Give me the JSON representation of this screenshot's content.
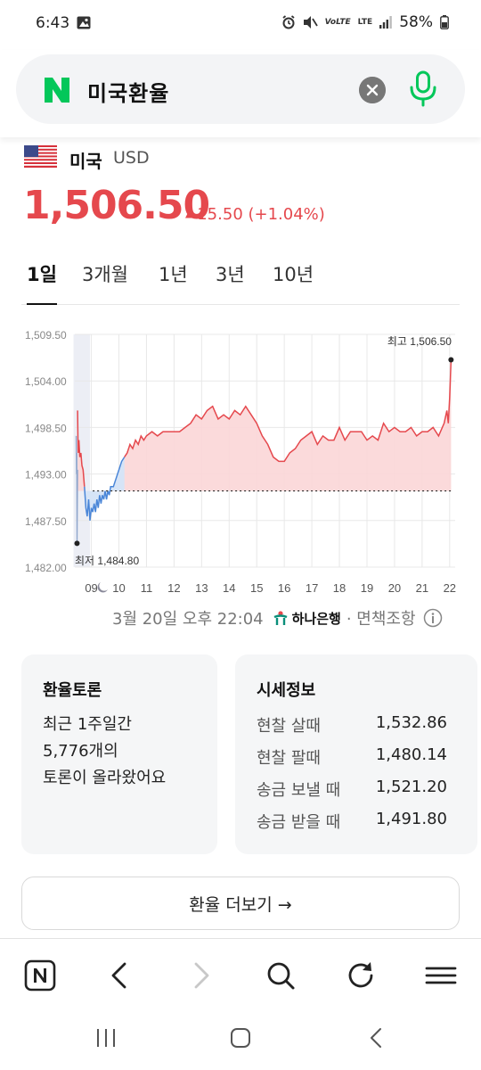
{
  "status_bar": {
    "time": "6:43",
    "network": "LTE",
    "volte": "VoLTE",
    "battery": "58%"
  },
  "search": {
    "query": "미국환율",
    "brand_color": "#03c75a"
  },
  "currency": {
    "country": "미국",
    "code": "USD",
    "rate": "1,506.50",
    "change": "15.50 (+1.04%)",
    "accent_color": "#e5484d"
  },
  "tabs": [
    {
      "label": "1일",
      "active": true
    },
    {
      "label": "3개월",
      "active": false
    },
    {
      "label": "1년",
      "active": false
    },
    {
      "label": "3년",
      "active": false
    },
    {
      "label": "10년",
      "active": false
    }
  ],
  "chart_data": {
    "type": "line",
    "y_ticks": [
      "1,509.50",
      "1,504.00",
      "1,498.50",
      "1,493.00",
      "1,487.50",
      "1,482.00"
    ],
    "ylim": [
      1482.0,
      1509.5
    ],
    "x_ticks": [
      "09",
      "10",
      "11",
      "12",
      "13",
      "14",
      "15",
      "16",
      "17",
      "18",
      "19",
      "20",
      "21",
      "22"
    ],
    "baseline": 1491.0,
    "high_label": "최고 1,506.50",
    "low_label": "최저 1,484.80",
    "series": [
      {
        "x": [
          8.5,
          8.52,
          8.55,
          8.58,
          8.62,
          8.66,
          8.7,
          8.75,
          8.8,
          8.85,
          8.9,
          8.95,
          9.0,
          9.05,
          9.1,
          9.15,
          9.2,
          9.25,
          9.3,
          9.35,
          9.4,
          9.45,
          9.5,
          9.55,
          9.6,
          9.65,
          9.7,
          9.8,
          9.9,
          10.0,
          10.1,
          10.2,
          10.3,
          10.4,
          10.5,
          10.6,
          10.7,
          10.8,
          10.9,
          11.0,
          11.2,
          11.4,
          11.6,
          11.8,
          12.0,
          12.2,
          12.4,
          12.6,
          12.8,
          13.0,
          13.2,
          13.4,
          13.6,
          13.8,
          14.0,
          14.2,
          14.4,
          14.6,
          14.8,
          15.0,
          15.2,
          15.4,
          15.6,
          15.8,
          16.0,
          16.2,
          16.4,
          16.6,
          16.8,
          17.0,
          17.2,
          17.4,
          17.6,
          17.8,
          18.0,
          18.2,
          18.4,
          18.6,
          18.8,
          19.0,
          19.2,
          19.4,
          19.6,
          19.8,
          20.0,
          20.2,
          20.4,
          20.6,
          20.8,
          21.0,
          21.2,
          21.4,
          21.6,
          21.8,
          21.9,
          21.95,
          22.0,
          22.05
        ],
        "values": [
          1500.5,
          1495.5,
          1497.0,
          1495.0,
          1495.5,
          1494.0,
          1493.5,
          1491.5,
          1489.0,
          1488.0,
          1490.0,
          1487.5,
          1489.0,
          1488.5,
          1489.5,
          1488.5,
          1490.0,
          1489.0,
          1490.5,
          1489.5,
          1490.5,
          1490.0,
          1491.0,
          1490.0,
          1491.0,
          1490.5,
          1491.5,
          1491.5,
          1492.5,
          1493.5,
          1494.5,
          1495.0,
          1495.5,
          1496.5,
          1496.0,
          1497.0,
          1496.5,
          1497.5,
          1497.0,
          1497.5,
          1498.0,
          1497.5,
          1498.0,
          1498.0,
          1498.0,
          1498.0,
          1498.5,
          1499.0,
          1500.0,
          1499.5,
          1500.5,
          1501.0,
          1499.5,
          1500.0,
          1499.5,
          1500.5,
          1500.0,
          1501.0,
          1500.0,
          1499.0,
          1497.5,
          1496.5,
          1495.0,
          1494.5,
          1494.5,
          1495.5,
          1496.0,
          1497.0,
          1497.5,
          1498.0,
          1496.5,
          1497.5,
          1497.0,
          1497.0,
          1498.5,
          1497.0,
          1498.0,
          1498.0,
          1498.0,
          1497.0,
          1497.5,
          1497.0,
          1499.0,
          1498.0,
          1498.5,
          1498.0,
          1498.0,
          1498.5,
          1497.5,
          1498.0,
          1498.0,
          1498.5,
          1497.5,
          1499.0,
          1500.5,
          1499.0,
          1502.0,
          1506.5
        ]
      }
    ],
    "pre_market": {
      "x": [
        8.45,
        8.46,
        8.47,
        8.48,
        8.5
      ],
      "values": [
        1497.5,
        1493.0,
        1495.5,
        1484.8,
        1493.5
      ]
    },
    "grid": true
  },
  "source": {
    "timestamp": "3월 20일 오후 22:04",
    "bank": "하나은행",
    "disclaimer": "· 면책조항"
  },
  "forum_card": {
    "title": "환율토론",
    "lines": [
      "최근 1주일간",
      "5,776개의",
      "토론이 올라왔어요"
    ]
  },
  "quote_card": {
    "title": "시세정보",
    "rows": [
      {
        "label": "현찰 살때",
        "value": "1,532.86"
      },
      {
        "label": "현찰 팔때",
        "value": "1,480.14"
      },
      {
        "label": "송금 보낼 때",
        "value": "1,521.20"
      },
      {
        "label": "송금 받을 때",
        "value": "1,491.80"
      }
    ]
  },
  "more_button": "환율 더보기 →",
  "browser_bar": [
    "naver-home-icon",
    "back-icon",
    "forward-icon",
    "search-icon",
    "refresh-icon",
    "menu-icon"
  ],
  "system_nav": [
    "recent-apps-icon",
    "home-icon",
    "back-icon"
  ]
}
